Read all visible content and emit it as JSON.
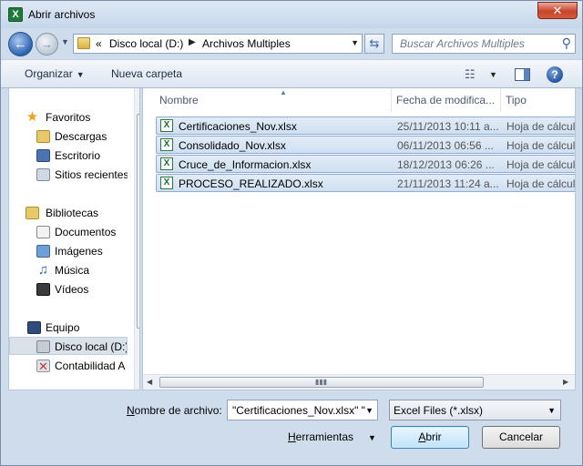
{
  "window": {
    "title": "Abrir archivos",
    "close_glyph": "✕"
  },
  "address": {
    "prefix": "«",
    "segments": [
      "Disco local (D:)",
      "Archivos Multiples"
    ],
    "search_placeholder": "Buscar Archivos Multiples"
  },
  "toolbar": {
    "organize": "Organizar",
    "new_folder": "Nueva carpeta"
  },
  "nav": {
    "favorites": {
      "label": "Favoritos",
      "items": [
        "Descargas",
        "Escritorio",
        "Sitios recientes"
      ]
    },
    "libraries": {
      "label": "Bibliotecas",
      "items": [
        "Documentos",
        "Imágenes",
        "Música",
        "Vídeos"
      ]
    },
    "computer": {
      "label": "Equipo",
      "items": [
        "Disco local (D:)",
        "Contabilidad A"
      ]
    }
  },
  "columns": {
    "name": "Nombre",
    "date": "Fecha de modifica...",
    "type": "Tipo"
  },
  "files": [
    {
      "name": "Certificaciones_Nov.xlsx",
      "date": "25/11/2013 10:11 a...",
      "type": "Hoja de cálculo"
    },
    {
      "name": "Consolidado_Nov.xlsx",
      "date": "06/11/2013 06:56 ...",
      "type": "Hoja de cálculo"
    },
    {
      "name": "Cruce_de_Informacion.xlsx",
      "date": "18/12/2013 06:26 ...",
      "type": "Hoja de cálculo"
    },
    {
      "name": "PROCESO_REALIZADO.xlsx",
      "date": "21/11/2013 11:24 a...",
      "type": "Hoja de cálculo"
    }
  ],
  "footer": {
    "filename_label_u": "N",
    "filename_label_rest": "ombre de archivo:",
    "filename_value": "\"Certificaciones_Nov.xlsx\" \"",
    "filter_value": "Excel Files (*.xlsx)",
    "tools_u": "H",
    "tools_rest": "erramientas",
    "open_u": "A",
    "open_rest": "brir",
    "cancel": "Cancelar"
  }
}
